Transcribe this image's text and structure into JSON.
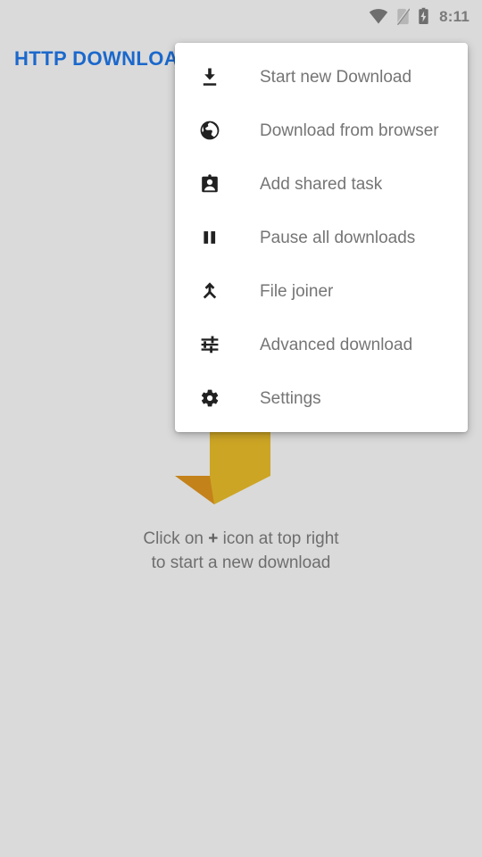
{
  "status_bar": {
    "time": "8:11",
    "icons": [
      {
        "name": "wifi-icon",
        "label": "wifi"
      },
      {
        "name": "no-sim-icon",
        "label": "no SIM card"
      },
      {
        "name": "battery-charging-icon",
        "label": "battery charging"
      }
    ]
  },
  "app": {
    "title": "HTTP DOWNLOADER",
    "title_color": "#1b68cc",
    "background_color": "#dadada"
  },
  "hint": {
    "line1_before": "Click on ",
    "line1_plus": "+",
    "line1_after": " icon at top right",
    "line2": "to start a new download",
    "arrow_color": "#cca525",
    "arrow_shadow_color": "#c4821a"
  },
  "overflow_menu": {
    "background_color": "#ffffff",
    "text_color": "#757575",
    "items": [
      {
        "icon": "download-icon",
        "label": "Start new Download"
      },
      {
        "icon": "globe-icon",
        "label": "Download from browser"
      },
      {
        "icon": "contact-badge-icon",
        "label": "Add shared task"
      },
      {
        "icon": "pause-icon",
        "label": "Pause all downloads"
      },
      {
        "icon": "merge-icon",
        "label": "File joiner"
      },
      {
        "icon": "tune-sliders-icon",
        "label": "Advanced download"
      },
      {
        "icon": "gear-icon",
        "label": "Settings"
      }
    ]
  }
}
